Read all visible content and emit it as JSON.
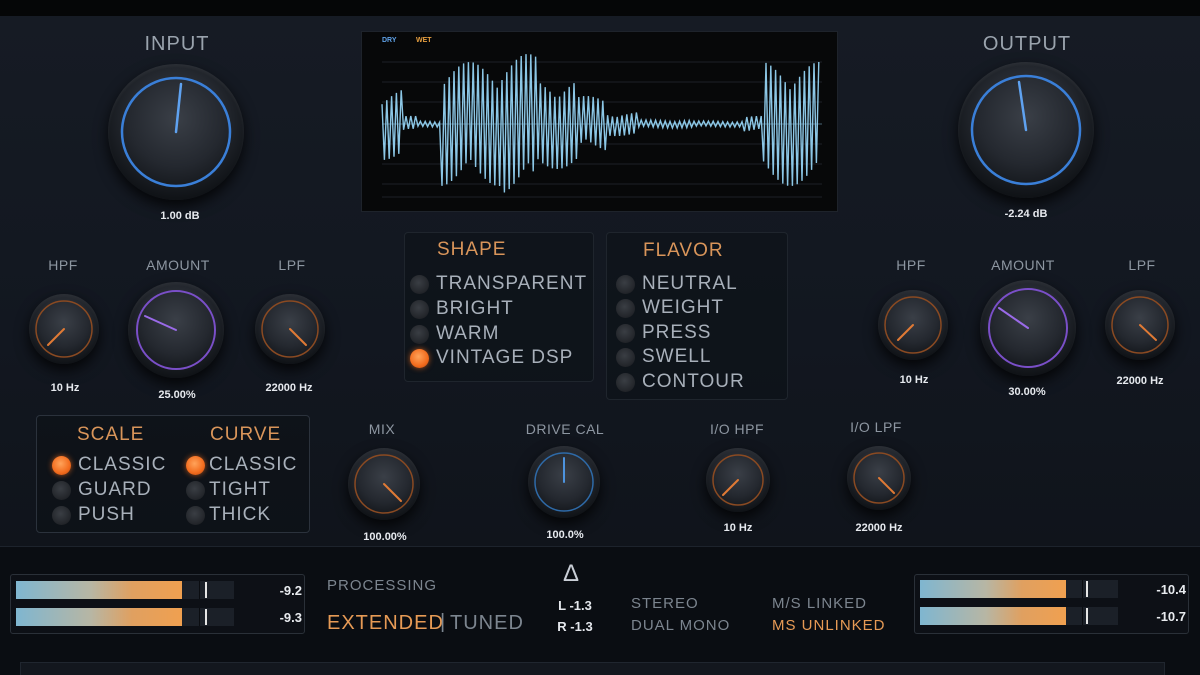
{
  "input": {
    "label": "INPUT",
    "value": "1.00 dB"
  },
  "output": {
    "label": "OUTPUT",
    "value": "-2.24 dB"
  },
  "scope": {
    "dry_label": "DRY",
    "wet_label": "WET"
  },
  "left_filters": {
    "hpf": {
      "label": "HPF",
      "value": "10 Hz"
    },
    "amount": {
      "label": "AMOUNT",
      "value": "25.00%"
    },
    "lpf": {
      "label": "LPF",
      "value": "22000 Hz"
    }
  },
  "right_filters": {
    "hpf": {
      "label": "HPF",
      "value": "10 Hz"
    },
    "amount": {
      "label": "AMOUNT",
      "value": "30.00%"
    },
    "lpf": {
      "label": "LPF",
      "value": "22000 Hz"
    }
  },
  "shape": {
    "title": "SHAPE",
    "options": [
      "TRANSPARENT",
      "BRIGHT",
      "WARM",
      "VINTAGE DSP"
    ],
    "selected": "VINTAGE DSP"
  },
  "flavor": {
    "title": "FLAVOR",
    "options": [
      "NEUTRAL",
      "WEIGHT",
      "PRESS",
      "SWELL",
      "CONTOUR"
    ]
  },
  "scale": {
    "title": "SCALE",
    "options": [
      "CLASSIC",
      "GUARD",
      "PUSH"
    ],
    "selected": "CLASSIC"
  },
  "curve": {
    "title": "CURVE",
    "options": [
      "CLASSIC",
      "TIGHT",
      "THICK"
    ],
    "selected": "CLASSIC"
  },
  "mix": {
    "label": "MIX",
    "value": "100.00%"
  },
  "drive_cal": {
    "label": "DRIVE CAL",
    "value": "100.0%"
  },
  "io_hpf": {
    "label": "I/O HPF",
    "value": "10 Hz"
  },
  "io_lpf": {
    "label": "I/O LPF",
    "value": "22000 Hz"
  },
  "input_meter": {
    "top": "-9.2",
    "bottom": "-9.3"
  },
  "output_meter": {
    "top": "-10.4",
    "bottom": "-10.7"
  },
  "processing": {
    "label": "PROCESSING",
    "extended": "EXTENDED",
    "separator": "|",
    "tuned": "TUNED",
    "active": "EXTENDED"
  },
  "delta": {
    "symbol": "Δ",
    "left": "L -1.3",
    "right": "R -1.3"
  },
  "stereo_mode": {
    "stereo": "STEREO",
    "dual_mono": "DUAL MONO"
  },
  "ms_mode": {
    "linked": "M/S LINKED",
    "unlinked": "MS UNLINKED",
    "active": "MS UNLINKED"
  },
  "colors": {
    "accent_orange": "#f26b1d",
    "knob_blue": "#3a7fd8",
    "knob_purple": "#7a4fc8",
    "waveform": "#8cc7e6"
  }
}
